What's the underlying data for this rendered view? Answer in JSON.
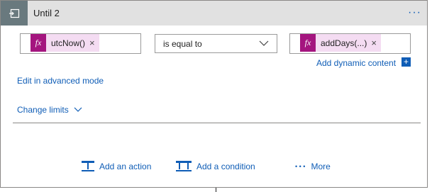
{
  "header": {
    "title": "Until 2",
    "menu": "···"
  },
  "condition": {
    "left": {
      "fx": "fx",
      "label": "utcNow()",
      "remove": "×"
    },
    "operator": "is equal to",
    "right": {
      "fx": "fx",
      "label": "addDays(...)",
      "remove": "×"
    }
  },
  "links": {
    "add_dynamic": "Add dynamic content",
    "add_dynamic_plus": "+",
    "edit_advanced": "Edit in advanced mode",
    "change_limits": "Change limits"
  },
  "actions": {
    "add_action": "Add an action",
    "add_condition": "Add a condition",
    "more_dots": "• • •",
    "more": "More"
  },
  "colors": {
    "header_bg": "#e1e1e1",
    "icon_box": "#69797e",
    "link": "#0f5db6",
    "fx_bg": "#a4157f",
    "token_bg": "#f4dcf2"
  }
}
